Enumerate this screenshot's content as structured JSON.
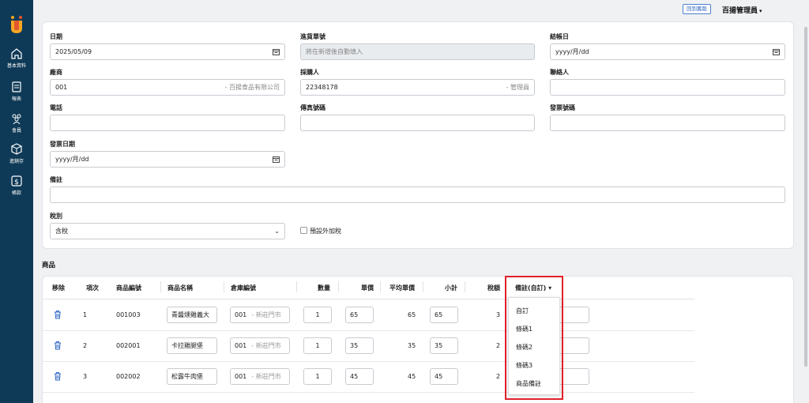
{
  "sidebar": {
    "items": [
      {
        "label": "基本資料",
        "icon": "home-icon"
      },
      {
        "label": "報表",
        "icon": "document-icon"
      },
      {
        "label": "會員",
        "icon": "users-icon"
      },
      {
        "label": "進銷存",
        "icon": "box-icon"
      },
      {
        "label": "帳款",
        "icon": "dollar-icon"
      }
    ]
  },
  "topbar": {
    "back_label": "回到舊版",
    "user_label": "百揚管理員",
    "user_caret": "▾"
  },
  "form": {
    "date": {
      "label": "日期",
      "value": "2025/05/09"
    },
    "receipt_no": {
      "label": "進貨單號",
      "placeholder": "將在新增後自動填入"
    },
    "checkout_date": {
      "label": "結帳日",
      "placeholder": "yyyy/月/dd"
    },
    "vendor": {
      "label": "廠商",
      "value": "001",
      "suffix": "- 百揚食品有限公司"
    },
    "buyer": {
      "label": "採購人",
      "value": "22348178",
      "suffix": "- 管理員"
    },
    "contact": {
      "label": "聯絡人",
      "value": ""
    },
    "phone": {
      "label": "電話",
      "value": ""
    },
    "fax": {
      "label": "傳真號碼",
      "value": ""
    },
    "invoice_no": {
      "label": "發票號碼",
      "value": ""
    },
    "invoice_date": {
      "label": "發票日期",
      "placeholder": "yyyy/月/dd"
    },
    "note": {
      "label": "備註",
      "value": ""
    },
    "tax_type": {
      "label": "稅別",
      "value": "含稅",
      "caret": "⌄"
    },
    "default_extra_tax": {
      "label": "預設外加稅",
      "checked": false
    }
  },
  "products": {
    "section_title": "商品",
    "columns": [
      "移除",
      "項次",
      "商品編號",
      "商品名稱",
      "倉庫編號",
      "數量",
      "單價",
      "平均單價",
      "小計",
      "稅額",
      "備註(自訂)"
    ],
    "note_caret": "▾",
    "rows": [
      {
        "index": "1",
        "code": "001003",
        "name": "青醬燻雞義大",
        "warehouse": "001",
        "warehouse_suffix": "- 新莊門市",
        "qty": "1",
        "price": "65",
        "avg_price": "65",
        "subtotal": "65",
        "tax": "3"
      },
      {
        "index": "2",
        "code": "002001",
        "name": "卡拉雞腿堡",
        "warehouse": "001",
        "warehouse_suffix": "- 新莊門市",
        "qty": "1",
        "price": "35",
        "avg_price": "35",
        "subtotal": "35",
        "tax": "2"
      },
      {
        "index": "3",
        "code": "002002",
        "name": "松露牛肉堡",
        "warehouse": "001",
        "warehouse_suffix": "- 新莊門市",
        "qty": "1",
        "price": "45",
        "avg_price": "45",
        "subtotal": "45",
        "tax": "2"
      }
    ],
    "note_menu": [
      "自訂",
      "條碼1",
      "條碼2",
      "條碼3",
      "商品備註"
    ]
  },
  "colors": {
    "sidebar": "#0f3a57",
    "highlight": "#e0202a",
    "link": "#2f67c4"
  }
}
